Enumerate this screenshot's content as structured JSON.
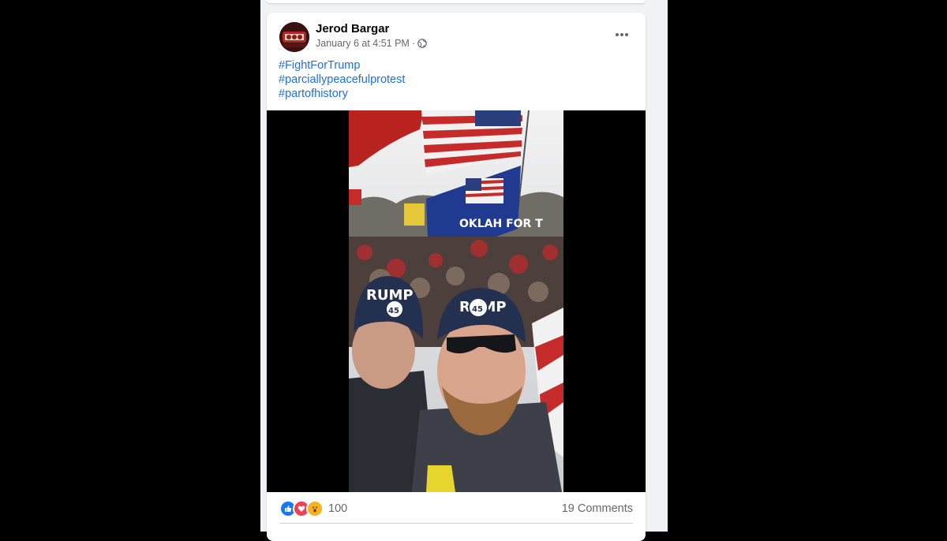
{
  "post": {
    "author": "Jerod Bargar",
    "timestamp": "January 6 at 4:51 PM",
    "separator": "·",
    "privacy_icon": "globe-icon",
    "more_icon": "more-horizontal-icon",
    "hashtags": [
      "#FightForTrump",
      "#parciallypeacefulprotest",
      "#partofhistory"
    ]
  },
  "media": {
    "type": "video-still",
    "hat_text_left": "RUMP",
    "hat_text_right": "RUMP",
    "hat_badge": "45",
    "flag_text": "OKLAH FOR T"
  },
  "reactions": {
    "icons": [
      "like-icon",
      "love-icon",
      "wow-icon"
    ],
    "count": "100",
    "comments": "19 Comments"
  },
  "colors": {
    "background": "#000000",
    "feed": "#f0f2f5",
    "card": "#ffffff",
    "link": "#216fdb",
    "secondary_text": "#65676b",
    "like": "#1877f2",
    "love": "#f33e58",
    "wow": "#f7b125"
  }
}
